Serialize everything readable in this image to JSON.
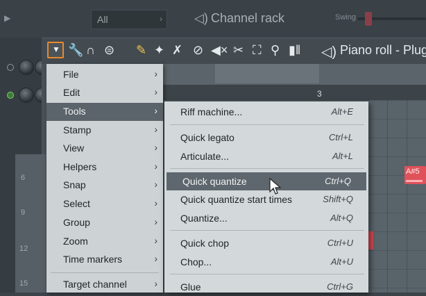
{
  "channel_rack": {
    "filter_value": "All",
    "title": "Channel rack",
    "swing_label": "Swing"
  },
  "piano_roll": {
    "title": "Piano roll - Plug",
    "bar_number": "3",
    "note_label": "A#5",
    "key_numbers": [
      "6",
      "9",
      "12",
      "15"
    ]
  },
  "toolbar": {
    "menu_icon": "triangle-down-icon",
    "tools": [
      "wrench-icon",
      "magnet-icon",
      "menu-circle-icon",
      "pencil-icon",
      "brush-icon",
      "delete-icon",
      "mute-icon",
      "slice-icon",
      "select-icon",
      "zoom-icon",
      "playback-icon"
    ]
  },
  "main_menu": {
    "items": [
      {
        "label": "File"
      },
      {
        "label": "Edit"
      },
      {
        "label": "Tools"
      },
      {
        "label": "Stamp"
      },
      {
        "label": "View"
      },
      {
        "label": "Helpers"
      },
      {
        "label": "Snap"
      },
      {
        "label": "Select"
      },
      {
        "label": "Group"
      },
      {
        "label": "Zoom"
      },
      {
        "label": "Time markers"
      },
      {
        "label": "Target channel"
      }
    ],
    "active": "Tools"
  },
  "tools_submenu": {
    "items": [
      {
        "label": "Riff machine...",
        "shortcut": "Alt+E"
      },
      {
        "label": "Quick legato",
        "shortcut": "Ctrl+L"
      },
      {
        "label": "Articulate...",
        "shortcut": "Alt+L"
      },
      {
        "label": "Quick quantize",
        "shortcut": "Ctrl+Q"
      },
      {
        "label": "Quick quantize start times",
        "shortcut": "Shift+Q"
      },
      {
        "label": "Quantize...",
        "shortcut": "Alt+Q"
      },
      {
        "label": "Quick chop",
        "shortcut": "Ctrl+U"
      },
      {
        "label": "Chop...",
        "shortcut": "Alt+U"
      },
      {
        "label": "Glue",
        "shortcut": "Ctrl+G"
      }
    ],
    "highlighted": "Quick quantize"
  },
  "colors": {
    "accent_orange": "#e88a2b",
    "note_red": "#e0525a",
    "menu_bg": "#cdd2d5",
    "highlight_bg": "#5e676d"
  }
}
